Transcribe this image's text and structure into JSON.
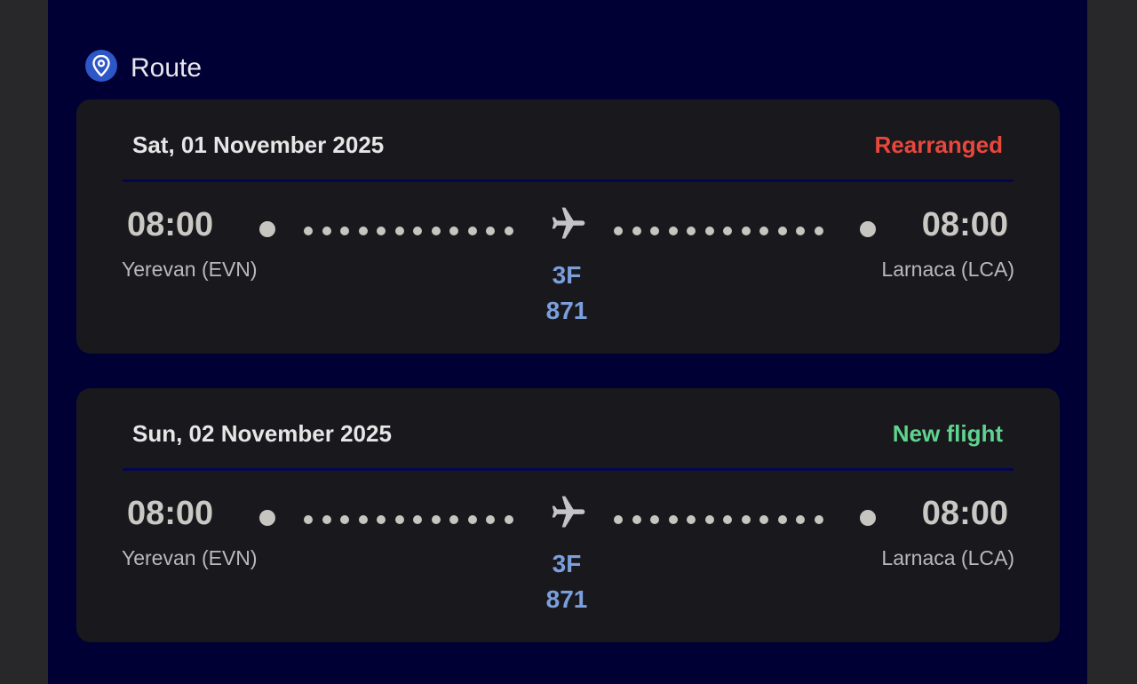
{
  "section": {
    "title": "Route",
    "icon": "location-pin-icon"
  },
  "colors": {
    "rearranged": "#e8473c",
    "new_flight": "#5fd48e",
    "flight_number": "#7b9fdd",
    "panel_bg": "#010035",
    "card_bg": "#19191d"
  },
  "flights": [
    {
      "date": "Sat, 01 November 2025",
      "status": "Rearranged",
      "departure_time": "08:00",
      "departure_city": "Yerevan (EVN)",
      "arrival_time": "08:00",
      "arrival_city": "Larnaca (LCA)",
      "airline_code": "3F",
      "flight_number": "871"
    },
    {
      "date": "Sun, 02 November 2025",
      "status": "New flight",
      "departure_time": "08:00",
      "departure_city": "Yerevan (EVN)",
      "arrival_time": "08:00",
      "arrival_city": "Larnaca (LCA)",
      "airline_code": "3F",
      "flight_number": "871"
    }
  ]
}
